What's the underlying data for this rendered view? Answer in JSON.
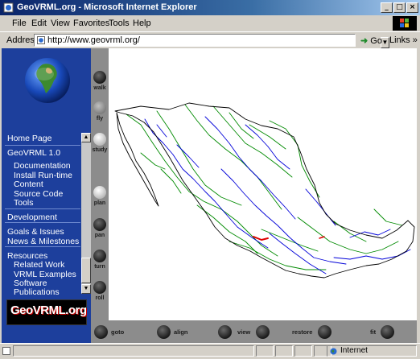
{
  "window": {
    "title": "GeoVRML.org - Microsoft Internet Explorer",
    "controls": [
      "_",
      "□",
      "×"
    ]
  },
  "menubar": {
    "items": [
      "File",
      "Edit",
      "View",
      "Favorites",
      "Tools",
      "Help"
    ]
  },
  "address": {
    "label": "Address",
    "url": "http://www.geovrml.org/",
    "go_label": "Go",
    "links_label": "Links",
    "links_arrow": "»"
  },
  "sidebar": {
    "nav": [
      {
        "label": "Home Page",
        "indent": false
      },
      {
        "label": "GeoVRML 1.0",
        "indent": false
      },
      {
        "label": "Documentation",
        "indent": true
      },
      {
        "label": "Install Run-time",
        "indent": true
      },
      {
        "label": "Content",
        "indent": true
      },
      {
        "label": "Source Code",
        "indent": true
      },
      {
        "label": "Tools",
        "indent": true
      },
      {
        "label": "Development",
        "indent": false
      },
      {
        "label": "Goals & Issues",
        "indent": false
      },
      {
        "label": "News & Milestones",
        "indent": false
      },
      {
        "label": "Resources",
        "indent": false
      },
      {
        "label": "Related Work",
        "indent": true
      },
      {
        "label": "VRML Examples",
        "indent": true
      },
      {
        "label": "Software",
        "indent": true
      },
      {
        "label": "Publications",
        "indent": true
      }
    ],
    "logo_text": "GeoVRML.org"
  },
  "vrml_nav": {
    "modes": [
      "walk",
      "fly",
      "study",
      "plan",
      "pan",
      "turn",
      "roll"
    ],
    "bottom": [
      "goto",
      "align",
      "view",
      "restore",
      "fit"
    ]
  },
  "status": {
    "zone": "Internet"
  },
  "colors": {
    "sidebar_bg": "#1d3f9c",
    "titlebar_start": "#0a246a",
    "map_roads": "#0000d8",
    "map_rivers": "#008a00",
    "map_border": "#000000",
    "map_highlight": "#e00000"
  }
}
